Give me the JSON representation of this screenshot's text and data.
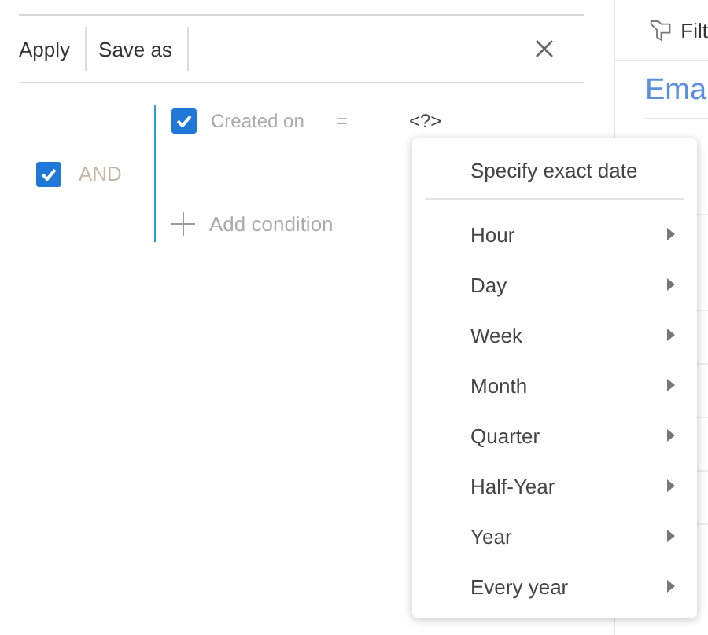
{
  "toolbar": {
    "buttons": [
      "Apply",
      "Save as"
    ]
  },
  "filter": {
    "checked": true,
    "operator": "AND",
    "conditions": [
      {
        "checked": true,
        "column": "Created on",
        "comparison": "=",
        "value": "<?>"
      }
    ],
    "add_label": "Add condition"
  },
  "menu": {
    "sections": [
      [
        {
          "label": "Specify exact date",
          "has_submenu": false
        }
      ],
      [
        {
          "label": "Hour",
          "has_submenu": true
        },
        {
          "label": "Day",
          "has_submenu": true
        },
        {
          "label": "Week",
          "has_submenu": true
        },
        {
          "label": "Month",
          "has_submenu": true
        },
        {
          "label": "Quarter",
          "has_submenu": true
        },
        {
          "label": "Half-Year",
          "has_submenu": true
        },
        {
          "label": "Year",
          "has_submenu": true
        },
        {
          "label": "Every year",
          "has_submenu": true
        }
      ]
    ]
  },
  "side_panel": {
    "header": "Filt",
    "title": "Ema"
  }
}
